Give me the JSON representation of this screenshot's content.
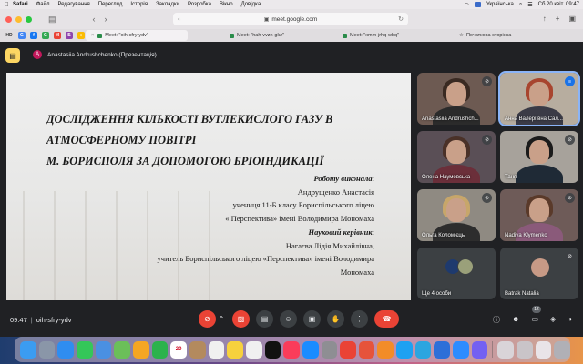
{
  "menubar": {
    "items": [
      "Safari",
      "Файл",
      "Редагування",
      "Перегляд",
      "Історія",
      "Закладки",
      "Розробка",
      "Вікно",
      "Довідка"
    ],
    "keyboard": "Українська",
    "datetime": "Сб 20 квіт.  09:47"
  },
  "browser": {
    "url": "meet.google.com",
    "favorites": [
      "HD",
      "G",
      "f",
      "G",
      "M",
      "Б",
      "♦"
    ],
    "tabs": [
      {
        "label": "Meet: \"oih-sfry-ydv\"",
        "active": true
      },
      {
        "label": "Meet: \"hah-vvzn-gkz\"",
        "active": false
      },
      {
        "label": "Meet: \"xmm-jrhq-wbq\"",
        "active": false
      },
      {
        "label": "Початкова сторінка",
        "active": false
      }
    ]
  },
  "meet": {
    "presenter_initial": "A",
    "presenter_label": "Anastasiia Andrushchenko (Презентація)",
    "slide": {
      "title_lines": [
        "ДОСЛІДЖЕННЯ КІЛЬКОСТІ ВУГЛЕКИСЛОГО ГАЗУ В",
        "АТМОСФЕРНОМУ ПОВІТРІ",
        "М. БОРИСПОЛЯ ЗА ДОПОМОГОЮ БРІОІНДИКАЦІЇ"
      ],
      "author_heading": "Роботу виконала",
      "author_lines": [
        "Андрущенко Анастасія",
        "учениця 11-Б класу Бориспільського ліцею",
        "« Перспектива» імені Володимира Мономаха"
      ],
      "advisor_heading": "Науковий керівник",
      "advisor_lines": [
        "Нагаєва Лідія Михайлівна,",
        "учитель Бориспільського ліцею «Перспектива» імені Володимира",
        "Мономаха"
      ]
    },
    "participants": [
      {
        "name": "Anastasiia Andrushch...",
        "mic_on": false
      },
      {
        "name": "Анна Валеріївна Сал...",
        "mic_on": true
      },
      {
        "name": "Олена Наумовська",
        "mic_on": false
      },
      {
        "name": "Таня",
        "mic_on": false
      },
      {
        "name": "Ольга Коломієць",
        "mic_on": false
      },
      {
        "name": "Nadiya Klymenko",
        "mic_on": false
      },
      {
        "name": "Ще 4 особи",
        "mic_on": false
      },
      {
        "name": "Batrak Natalia",
        "mic_on": false
      }
    ],
    "time": "09:47",
    "meeting_code": "oih-sfry-ydv",
    "people_count": "12"
  },
  "colors": {
    "meet_bg": "#202124",
    "end_call": "#ea4335",
    "accent": "#1a73e8"
  }
}
